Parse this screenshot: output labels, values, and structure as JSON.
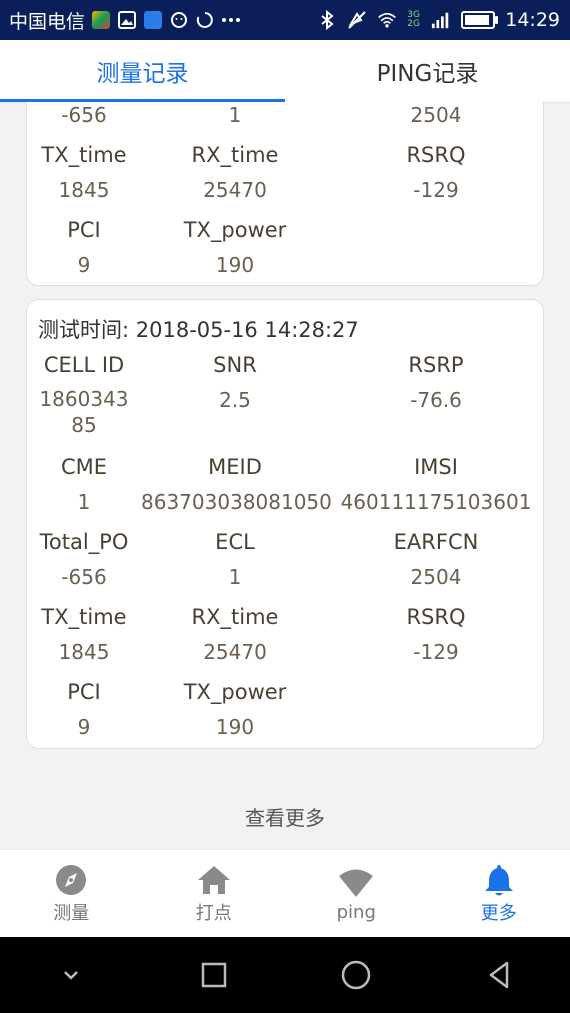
{
  "status_bar": {
    "carrier": "中国电信",
    "network": "3G 2G",
    "time": "14:29",
    "battery_percent": 90,
    "icons": [
      "app-icon",
      "image-icon",
      "notification-icon",
      "face-icon",
      "loading-icon",
      "more-dots",
      "bluetooth-icon",
      "mute-icon",
      "wifi-icon",
      "signal-icon",
      "battery-icon"
    ]
  },
  "tabs": [
    {
      "label": "测量记录",
      "active": true
    },
    {
      "label": "PING记录",
      "active": false
    }
  ],
  "card1": {
    "row_top": {
      "values": [
        "-656",
        "1",
        "2504"
      ]
    },
    "row2": {
      "labels": [
        "TX_time",
        "RX_time",
        "RSRQ"
      ],
      "values": [
        "1845",
        "25470",
        "-129"
      ]
    },
    "row3": {
      "labels": [
        "PCI",
        "TX_power"
      ],
      "values": [
        "9",
        "190"
      ]
    }
  },
  "card2": {
    "title": "测试时间: 2018-05-16 14:28:27",
    "row1": {
      "labels": [
        "CELL ID",
        "SNR",
        "RSRP"
      ],
      "values": [
        "186034385",
        "2.5",
        "-76.6"
      ]
    },
    "row2": {
      "labels": [
        "CME",
        "MEID",
        "IMSI"
      ],
      "values": [
        "1",
        "863703038081050",
        "460111175103601"
      ]
    },
    "row3": {
      "labels": [
        "Total_PO",
        "ECL",
        "EARFCN"
      ],
      "values": [
        "-656",
        "1",
        "2504"
      ]
    },
    "row4": {
      "labels": [
        "TX_time",
        "RX_time",
        "RSRQ"
      ],
      "values": [
        "1845",
        "25470",
        "-129"
      ]
    },
    "row5": {
      "labels": [
        "PCI",
        "TX_power"
      ],
      "values": [
        "9",
        "190"
      ]
    }
  },
  "more_link": "查看更多",
  "bottom_nav": [
    {
      "label": "测量",
      "icon": "compass-icon",
      "active": false
    },
    {
      "label": "打点",
      "icon": "home-icon",
      "active": false
    },
    {
      "label": "ping",
      "icon": "wifi-icon",
      "active": false
    },
    {
      "label": "更多",
      "icon": "bell-icon",
      "active": true
    }
  ],
  "system_nav": [
    "chevron-down-icon",
    "recents-icon",
    "home-circle-icon",
    "back-icon"
  ],
  "colors": {
    "accent": "#1a73e8",
    "status_bar": "#0a1f5a"
  }
}
